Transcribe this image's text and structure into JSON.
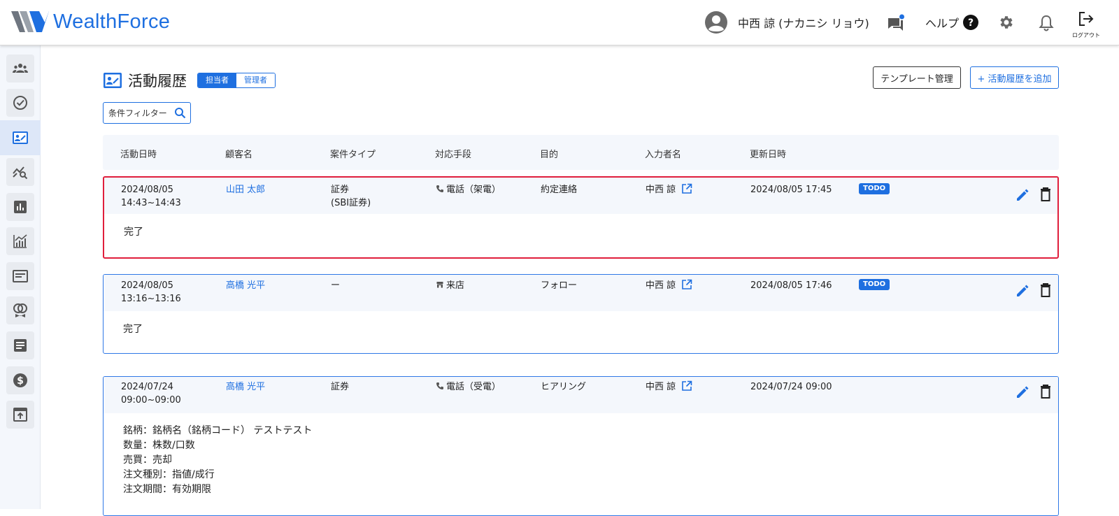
{
  "header": {
    "logo_bold": "Wealth",
    "logo_light": "Force",
    "user_name": "中西 諒 (ナカニシ リョウ)",
    "help_label": "ヘルプ",
    "logout_label": "ログアウト"
  },
  "colors": {
    "accent": "#1e6fe0",
    "selected_border": "#e01e3c",
    "row_bg": "#f4f7fc"
  },
  "sidebar": {
    "items": [
      {
        "icon": "customers-icon"
      },
      {
        "icon": "check-circle-icon"
      },
      {
        "icon": "activity-history-icon",
        "active": true
      },
      {
        "icon": "analysis-search-icon"
      },
      {
        "icon": "bar-chart-icon"
      },
      {
        "icon": "growth-chart-icon"
      },
      {
        "icon": "card-icon"
      },
      {
        "icon": "rings-icon"
      },
      {
        "icon": "document-icon"
      },
      {
        "icon": "dollar-icon"
      },
      {
        "icon": "upload-icon"
      }
    ]
  },
  "page": {
    "title": "活動履歴",
    "toggle": {
      "on": "担当者",
      "off": "管理者"
    },
    "template_button": "テンプレート管理",
    "add_button": "+ 活動履歴を追加",
    "filter_label": "条件フィルター"
  },
  "table": {
    "headers": [
      "活動日時",
      "顧客名",
      "案件タイプ",
      "対応手段",
      "目的",
      "入力者名",
      "更新日時"
    ],
    "rows": [
      {
        "date": "2024/08/05",
        "time": "14:43~14:43",
        "customer": "山田 太郎",
        "type": "証券",
        "type_sub": "(SBI証券)",
        "channel_icon": "phone-icon",
        "channel": "電話（架電）",
        "purpose": "約定連絡",
        "entered_by": "中西 諒",
        "updated": "2024/08/05 17:45",
        "badge": "TODO",
        "memo": "完了"
      },
      {
        "date": "2024/08/05",
        "time": "13:16~13:16",
        "customer": "高橋 光平",
        "type": "ー",
        "type_sub": "",
        "channel_icon": "store-icon",
        "channel": "来店",
        "purpose": "フォロー",
        "entered_by": "中西 諒",
        "updated": "2024/08/05 17:46",
        "badge": "TODO",
        "memo": "完了"
      },
      {
        "date": "2024/07/24",
        "time": "09:00~09:00",
        "customer": "高橋 光平",
        "type": "証券",
        "type_sub": "",
        "channel_icon": "phone-icon",
        "channel": "電話（受電）",
        "purpose": "ヒアリング",
        "entered_by": "中西 諒",
        "updated": "2024/07/24 09:00",
        "badge": "",
        "memo": "銘柄：銘柄名（銘柄コード） テストテスト\n数量：株数/口数\n売買：売却\n注文種別：指値/成行\n注文期間：有効期限"
      }
    ]
  }
}
